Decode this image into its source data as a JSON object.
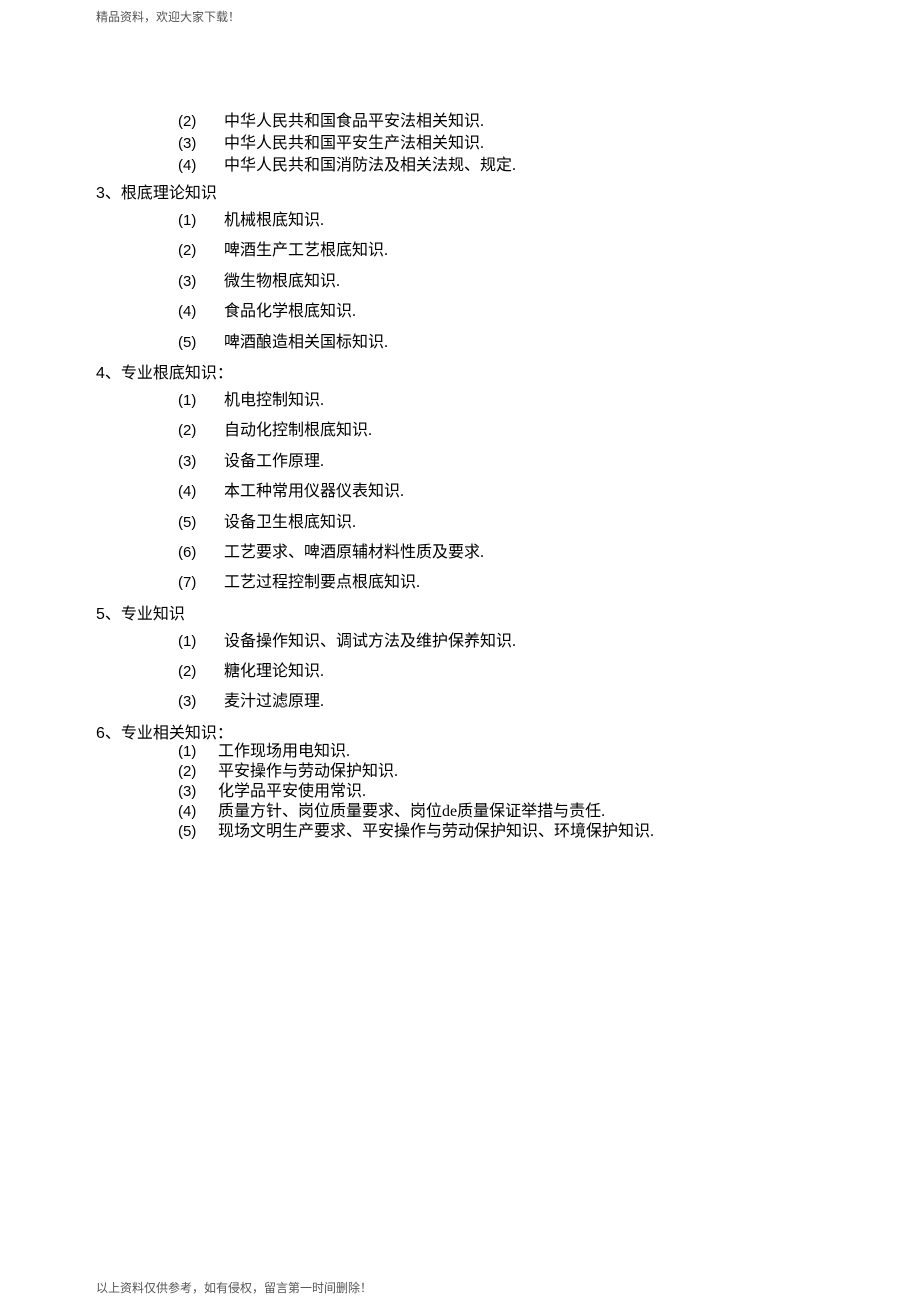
{
  "header": "精品资料，欢迎大家下载！",
  "footer": "以上资料仅供参考，如有侵权，留言第一时间删除！",
  "top_items": [
    {
      "marker": "(2)",
      "text": "中华人民共和国食品平安法相关知识."
    },
    {
      "marker": "(3)",
      "text": "中华人民共和国平安生产法相关知识."
    },
    {
      "marker": "(4)",
      "text": "中华人民共和国消防法及相关法规、规定."
    }
  ],
  "sections": [
    {
      "num": "3",
      "sep": "、",
      "title": "根底理论知识",
      "items": [
        {
          "marker": "(1)",
          "text": "机械根底知识."
        },
        {
          "marker": "(2)",
          "text": "啤酒生产工艺根底知识."
        },
        {
          "marker": "(3)",
          "text": "微生物根底知识."
        },
        {
          "marker": "(4)",
          "text": "食品化学根底知识."
        },
        {
          "marker": "(5)",
          "text": "啤酒酿造相关国标知识."
        }
      ]
    },
    {
      "num": "4",
      "sep": "、",
      "title": "专业根底知识：",
      "items": [
        {
          "marker": "(1)",
          "text": "机电控制知识."
        },
        {
          "marker": "(2)",
          "text": "自动化控制根底知识."
        },
        {
          "marker": "(3)",
          "text": "设备工作原理."
        },
        {
          "marker": "(4)",
          "text": "本工种常用仪器仪表知识."
        },
        {
          "marker": "(5)",
          "text": "设备卫生根底知识."
        },
        {
          "marker": "(6)",
          "text": "工艺要求、啤酒原辅材料性质及要求."
        },
        {
          "marker": "(7)",
          "text": "工艺过程控制要点根底知识."
        }
      ]
    },
    {
      "num": "5",
      "sep": "、",
      "title": "专业知识",
      "items": [
        {
          "marker": "(1)",
          "text": "设备操作知识、调试方法及维护保养知识."
        },
        {
          "marker": "(2)",
          "text": "糖化理论知识."
        },
        {
          "marker": "(3)",
          "text": "麦汁过滤原理."
        }
      ]
    },
    {
      "num": "6",
      "sep": "、",
      "title": "专业相关知识：",
      "items": [
        {
          "marker": "(1)",
          "text": "工作现场用电知识."
        },
        {
          "marker": "(2)",
          "text": "平安操作与劳动保护知识."
        },
        {
          "marker": "(3)",
          "text": "化学品平安使用常识."
        },
        {
          "marker": "(4)",
          "text": "质量方针、岗位质量要求、岗位de质量保证举措与责任."
        },
        {
          "marker": "(5)",
          "text": "现场文明生产要求、平安操作与劳动保护知识、环境保护知识."
        }
      ]
    }
  ]
}
